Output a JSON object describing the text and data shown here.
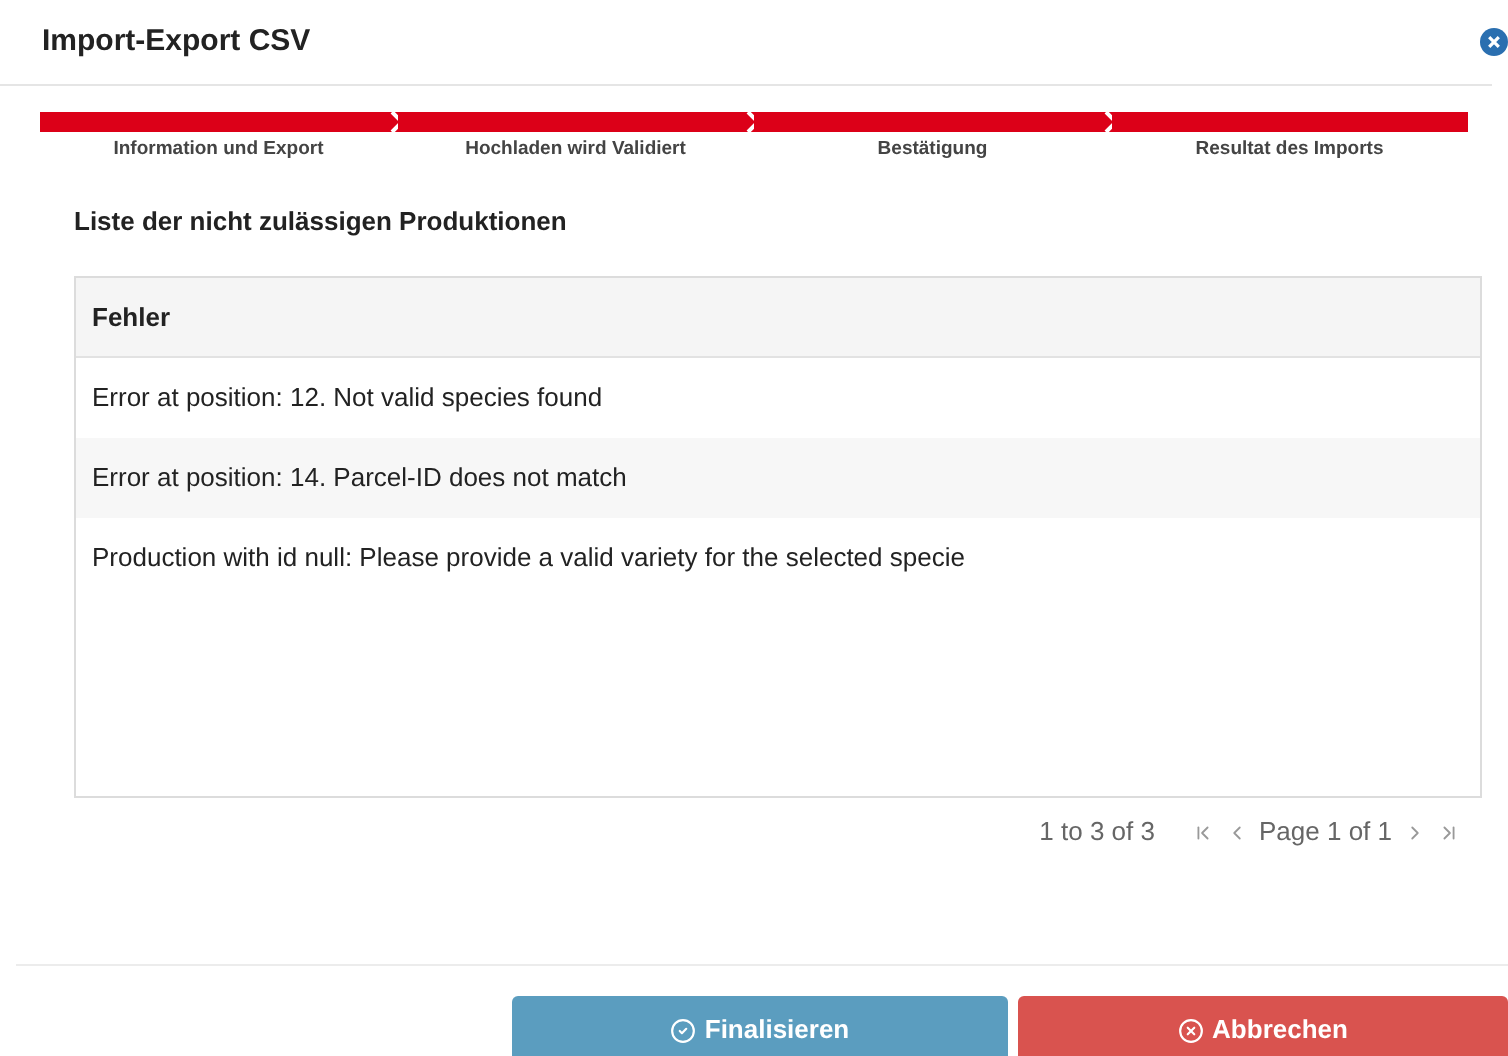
{
  "dialog": {
    "title": "Import-Export CSV"
  },
  "steps": [
    {
      "label": "Information und Export",
      "done": true
    },
    {
      "label": "Hochladen wird Validiert",
      "done": true
    },
    {
      "label": "Bestätigung",
      "done": true
    },
    {
      "label": "Resultat des Imports",
      "done": true
    }
  ],
  "section_title": "Liste der nicht zulässigen Produktionen",
  "table": {
    "columns": [
      "Fehler"
    ],
    "rows": [
      [
        "Error at position: 12. Not valid species found"
      ],
      [
        "Error at position: 14. Parcel-ID does not match"
      ],
      [
        "Production with id null: Please provide a valid variety for the selected specie"
      ]
    ]
  },
  "pagination": {
    "summary": "1 to 3 of 3",
    "page": "Page 1 of 1"
  },
  "buttons": [
    {
      "label": "Finalisieren",
      "kind": "confirm"
    },
    {
      "label": "Abbrechen",
      "kind": "cancel"
    }
  ]
}
